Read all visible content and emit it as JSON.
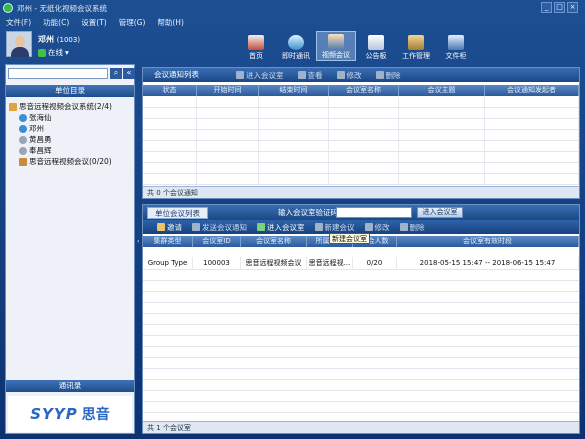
{
  "app": {
    "title": "邓州 - 无纸化视频会议系统"
  },
  "menu": [
    "文件(F)",
    "功能(C)",
    "设置(T)",
    "管理(G)",
    "帮助(H)"
  ],
  "window_controls": [
    "_",
    "□",
    "×"
  ],
  "user": {
    "name": "邓州",
    "id": "(1003)",
    "status": "在线"
  },
  "toolbar": [
    {
      "label": "首页",
      "icon": "home-icon"
    },
    {
      "label": "即时通讯",
      "icon": "chat-icon"
    },
    {
      "label": "视频会议",
      "icon": "video-conference-icon",
      "selected": true
    },
    {
      "label": "公告板",
      "icon": "bulletin-icon"
    },
    {
      "label": "工作管理",
      "icon": "work-manage-icon"
    },
    {
      "label": "文件柜",
      "icon": "file-cabinet-icon"
    }
  ],
  "left": {
    "search_placeholder": "",
    "dept_header": "单位目录",
    "tree": [
      {
        "label": "思音远程视频会议系统(2/4)",
        "level": 0,
        "icon": "org-icon"
      },
      {
        "label": "张海仙",
        "level": 1,
        "icon": "user-icon"
      },
      {
        "label": "邓州",
        "level": 1,
        "icon": "user-icon"
      },
      {
        "label": "黄昌勇",
        "level": 1,
        "icon": "user-icon"
      },
      {
        "label": "奉昌辉",
        "level": 1,
        "icon": "user-icon"
      },
      {
        "label": "思音远程视频会议(0/20)",
        "level": 1,
        "icon": "meeting-room-icon"
      }
    ],
    "contacts_header": "通讯录",
    "logo_text": "SYYP",
    "logo_cn": "思音"
  },
  "notice": {
    "tab": "会议通知列表",
    "buttons": [
      "进入会议室",
      "查看",
      "修改",
      "删除"
    ],
    "columns": [
      "状态",
      "开始时间",
      "结束时间",
      "会议室名称",
      "会议主题",
      "会议通知发起者"
    ],
    "footer": "共 0 个会议通知"
  },
  "rooms": {
    "tab": "单位会议列表",
    "code_label": "输入会议室验证码",
    "code_value": "",
    "enter_button": "进入会议室",
    "buttons": [
      "邀请",
      "发送会议通知",
      "进入会议室",
      "新建会议",
      "修改",
      "删除"
    ],
    "tooltip": "新建会议室",
    "columns": [
      "集群类型",
      "会议室ID",
      "会议室名称",
      "所属单位",
      "参会人数",
      "会议室有效时段"
    ],
    "rows": [
      [
        "Group Type",
        "100003",
        "思音远程视频会议",
        "思音远程视...",
        "0/20",
        "2018-05-15 15:47 -- 2018-06-15 15:47"
      ]
    ],
    "footer": "共 1 个会议室"
  },
  "colors": {
    "accent": "#1a4886",
    "selected_tab": "#9fc0e8"
  }
}
